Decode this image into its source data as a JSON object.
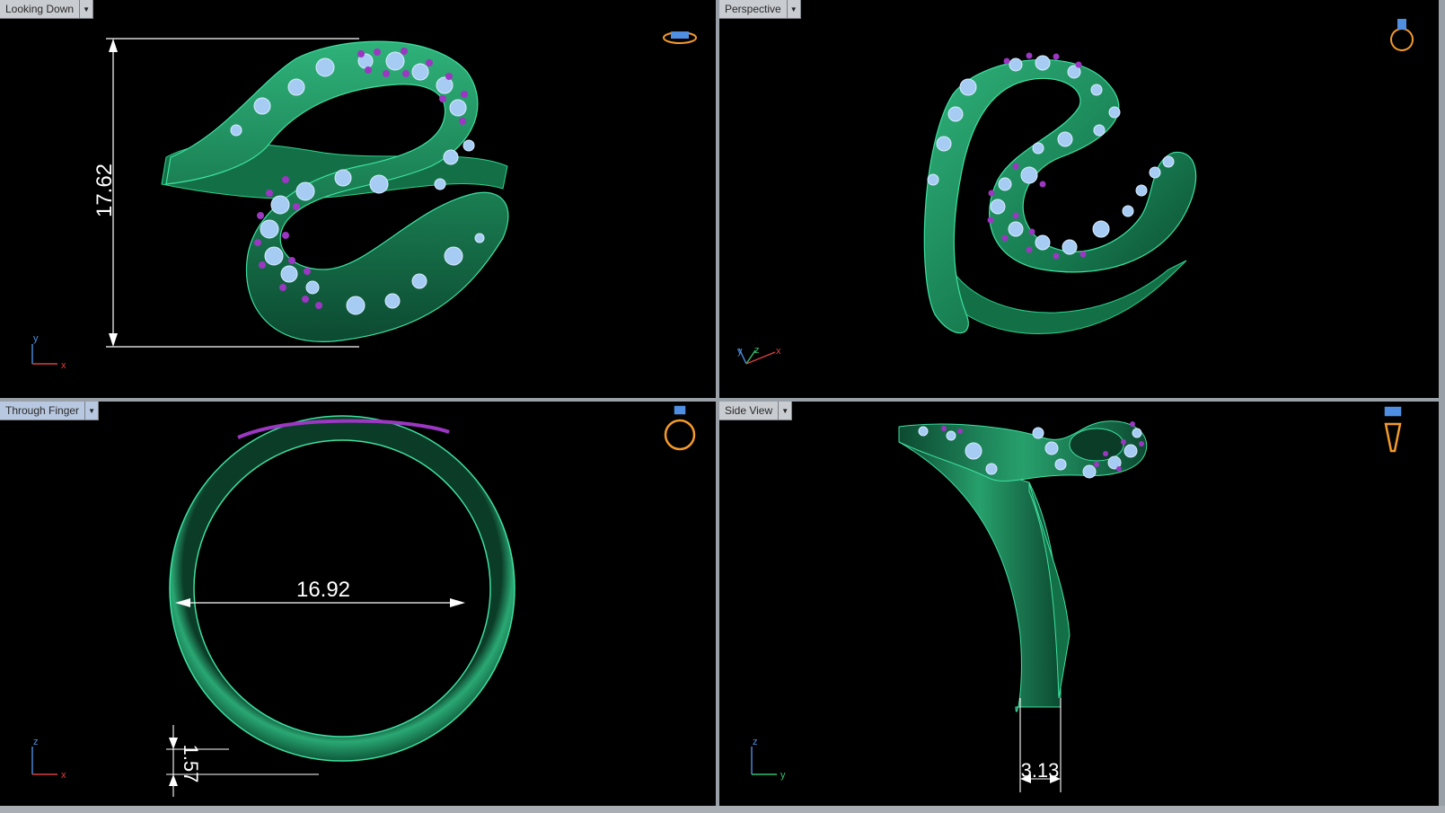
{
  "viewports": {
    "top": {
      "title": "Looking Down",
      "dimension": "17.62",
      "axes": {
        "x": "x",
        "y": "y"
      }
    },
    "perspective": {
      "title": "Perspective",
      "axes": {
        "x": "x",
        "y": "y",
        "z": "z"
      }
    },
    "front": {
      "title": "Through Finger",
      "dimension_main": "16.92",
      "dimension_small": "1.57",
      "axes": {
        "x": "x",
        "z": "z"
      }
    },
    "right": {
      "title": "Side View",
      "dimension": "3.13",
      "axes": {
        "y": "y",
        "z": "z"
      }
    }
  },
  "colors": {
    "metal": "#1f8a5c",
    "stone": "#9fc6f2",
    "prong": "#9b37c2",
    "gizmo": "#f39a2c",
    "dimension": "#ffffff"
  },
  "icons": {
    "dropdown": "chevron-down-icon",
    "view_gizmo": "ring-view-icon"
  }
}
